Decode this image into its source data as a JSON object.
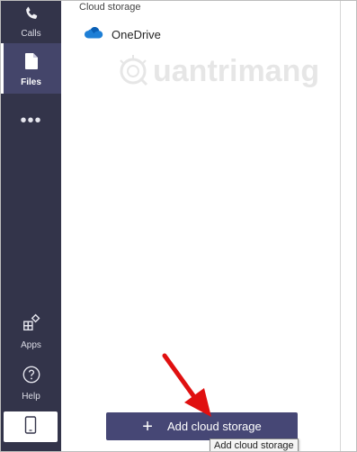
{
  "rail": {
    "calls_label": "Calls",
    "files_label": "Files",
    "more_label": "•••",
    "apps_label": "Apps",
    "help_label": "Help"
  },
  "panel": {
    "section_title": "Cloud storage",
    "providers": [
      {
        "name": "OneDrive",
        "icon": "onedrive-cloud-icon"
      }
    ],
    "add_button_label": "Add cloud storage",
    "tooltip": "Add cloud storage"
  },
  "watermark": {
    "text": "uantrimang"
  },
  "colors": {
    "rail_bg": "#33344a",
    "rail_active": "#44456a",
    "button_bg": "#464775",
    "onedrive_blue": "#1e7fd6",
    "annotation_arrow": "#e01010"
  }
}
